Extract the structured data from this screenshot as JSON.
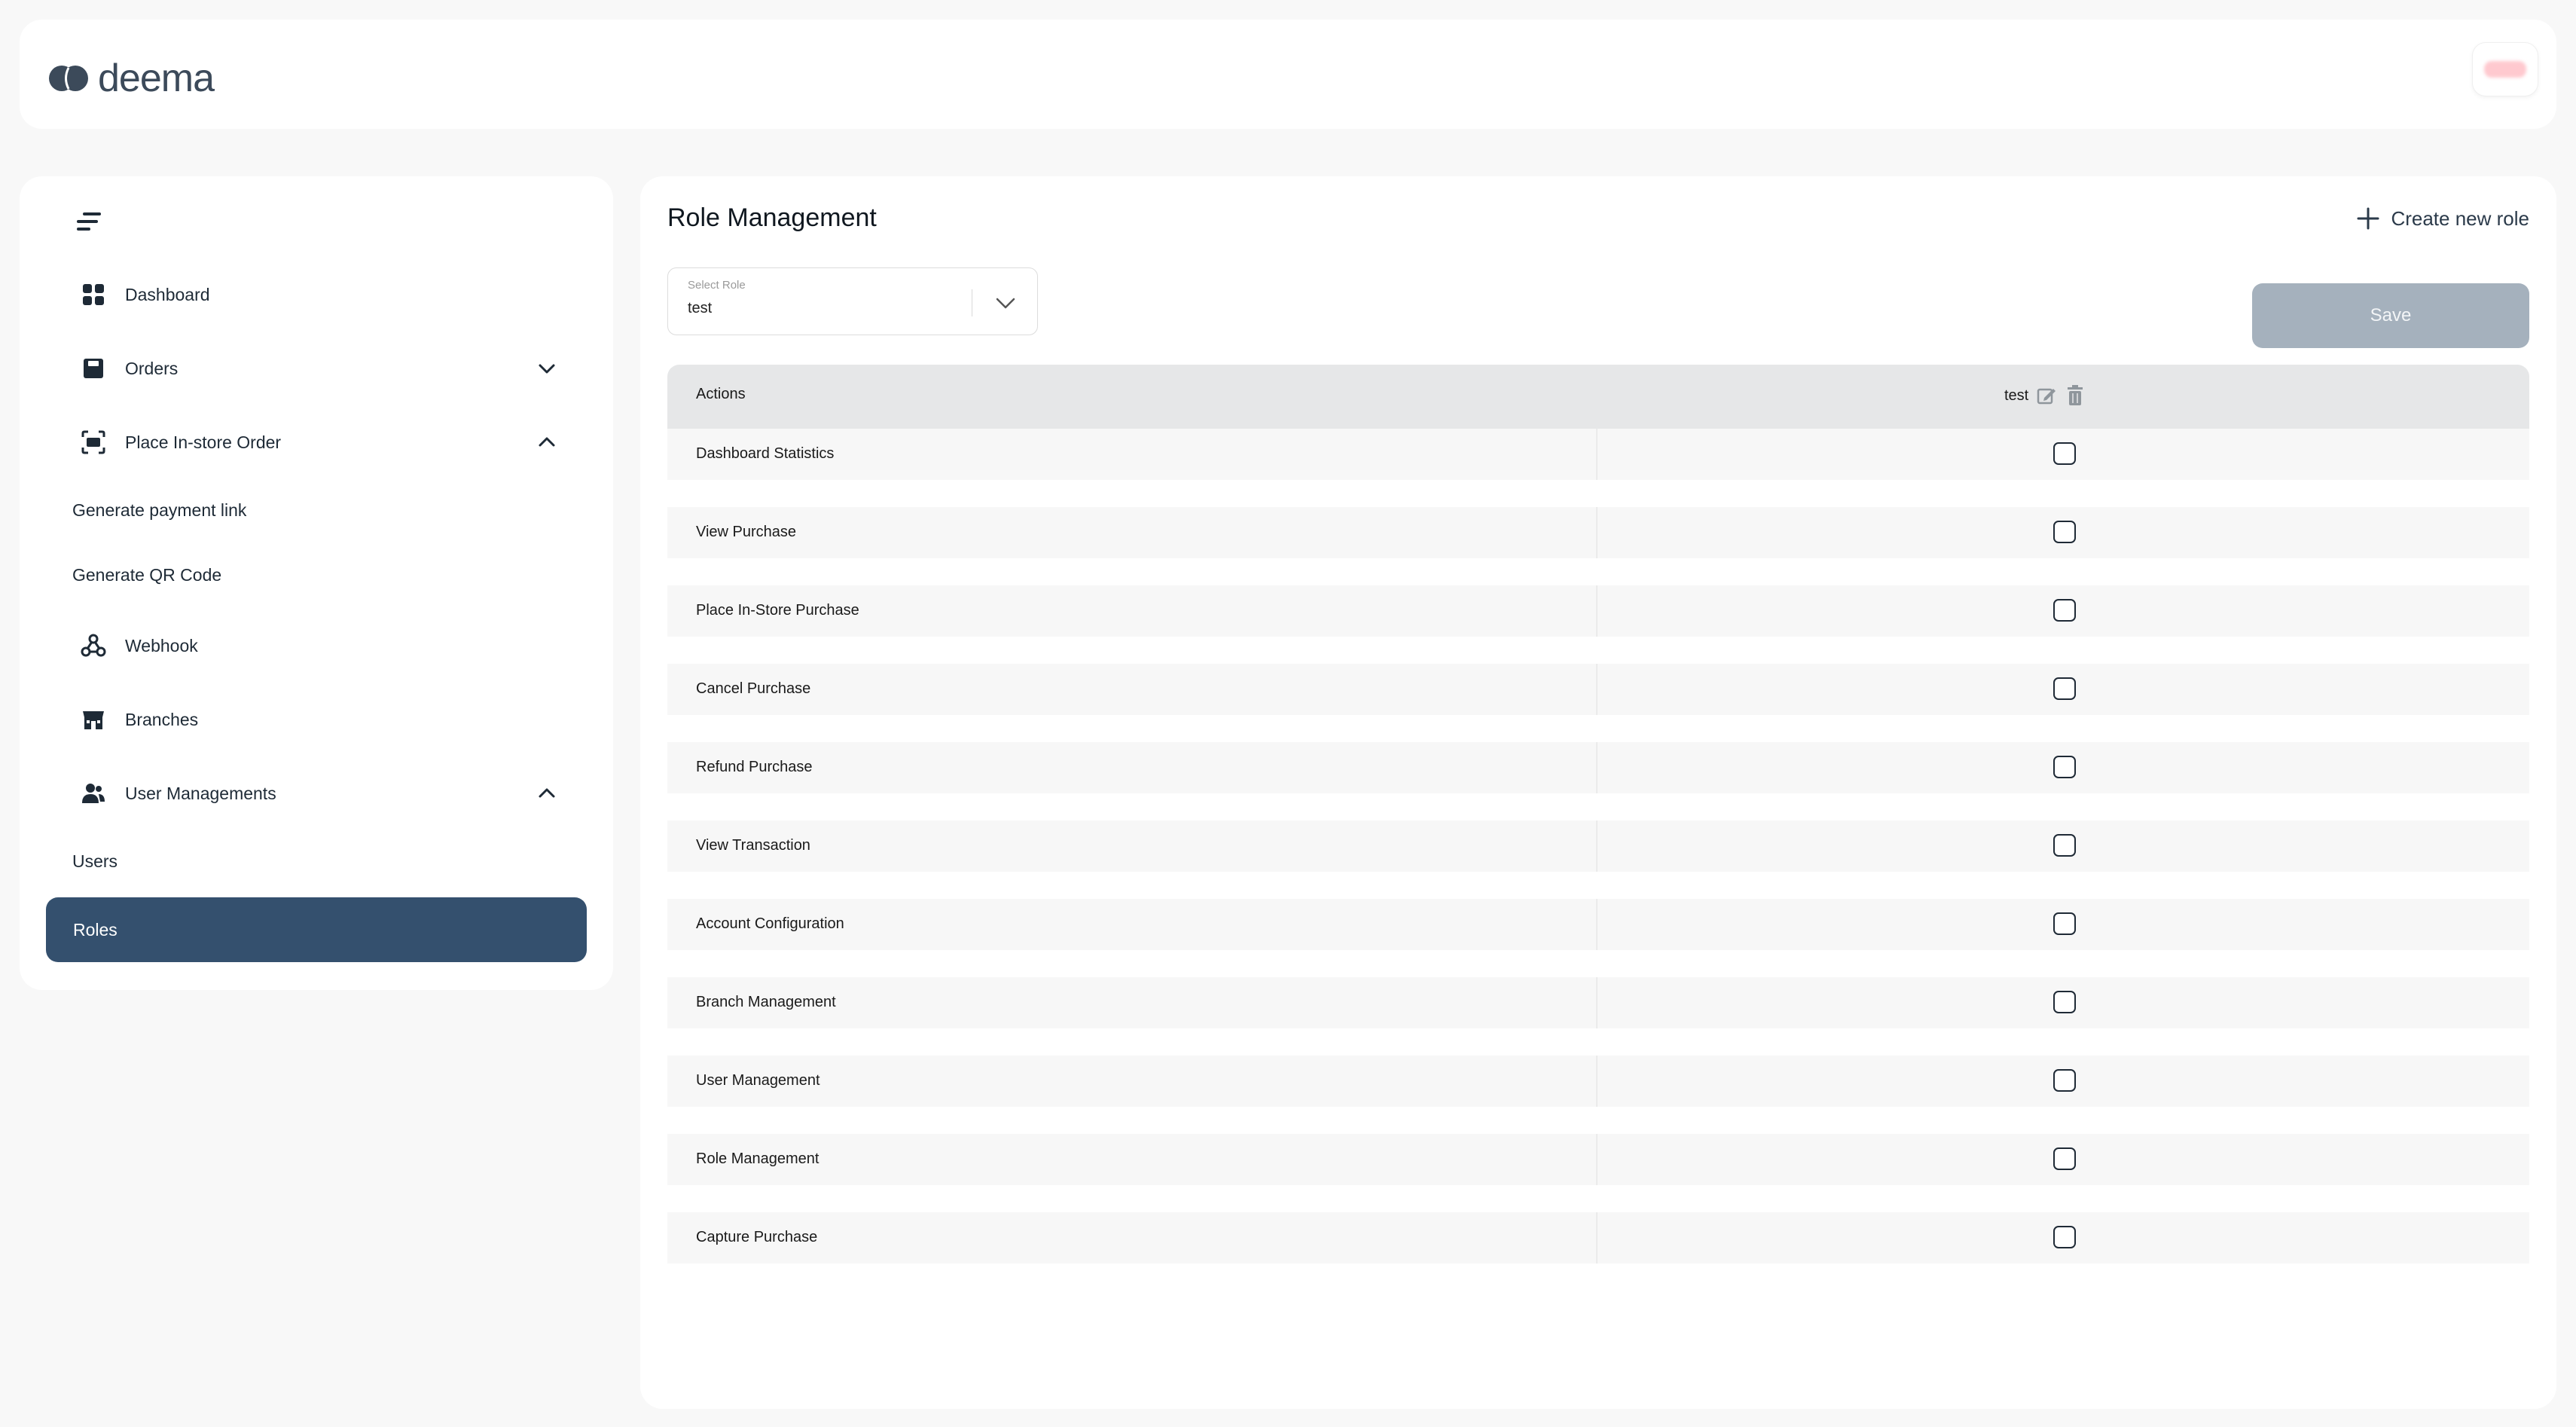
{
  "brand": {
    "name": "deema",
    "color": "#3c4a5a"
  },
  "sidebar": {
    "items": [
      {
        "label": "Dashboard",
        "icon": "dashboard-icon"
      },
      {
        "label": "Orders",
        "icon": "orders-icon",
        "expanded": false
      },
      {
        "label": "Place In-store Order",
        "icon": "scan-icon",
        "expanded": true
      },
      {
        "label": "Generate payment link"
      },
      {
        "label": "Generate QR Code"
      },
      {
        "label": "Webhook",
        "icon": "webhook-icon"
      },
      {
        "label": "Branches",
        "icon": "store-icon"
      },
      {
        "label": "User Managements",
        "icon": "users-icon",
        "expanded": true
      },
      {
        "label": "Users"
      },
      {
        "label": "Roles",
        "active": true
      }
    ],
    "active_color": "#34506e"
  },
  "main": {
    "title": "Role Management",
    "create_label": "Create new role",
    "select": {
      "label": "Select Role",
      "value": "test"
    },
    "save_label": "Save",
    "table": {
      "header_actions": "Actions",
      "role_column": "test",
      "rows": [
        {
          "action": "Dashboard Statistics",
          "checked": false
        },
        {
          "action": "View Purchase",
          "checked": false
        },
        {
          "action": "Place In-Store Purchase",
          "checked": false
        },
        {
          "action": "Cancel Purchase",
          "checked": false
        },
        {
          "action": "Refund Purchase",
          "checked": false
        },
        {
          "action": "View Transaction",
          "checked": false
        },
        {
          "action": "Account Configuration",
          "checked": false
        },
        {
          "action": "Branch Management",
          "checked": false
        },
        {
          "action": "User Management",
          "checked": false
        },
        {
          "action": "Role Management",
          "checked": false
        },
        {
          "action": "Capture Purchase",
          "checked": false
        }
      ]
    }
  }
}
